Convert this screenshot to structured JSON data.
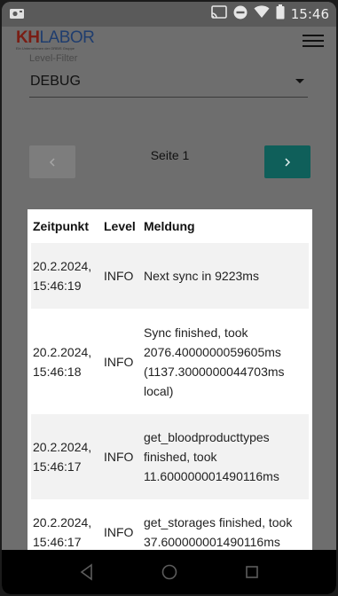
{
  "status_bar": {
    "time": "15:46",
    "icons": [
      "camera-notification-icon",
      "cast-icon",
      "do-not-disturb-icon",
      "wifi-icon",
      "battery-icon"
    ]
  },
  "header": {
    "logo_kh": "KH",
    "logo_labor": "LABOR",
    "logo_tagline": "Ein Unternehmen der ORBIS Gruppe",
    "menu_icon": "hamburger-menu-icon"
  },
  "filter": {
    "label": "Level-Filter",
    "value": "DEBUG"
  },
  "pager": {
    "page_label": "Seite 1",
    "prev_icon": "chevron-left-icon",
    "next_icon": "chevron-right-icon"
  },
  "log_table": {
    "columns": [
      "Zeitpunkt",
      "Level",
      "Meldung"
    ],
    "rows": [
      {
        "date": "20.2.2024,",
        "time": "15:46:19",
        "level": "INFO",
        "message": "Next sync in 9223ms"
      },
      {
        "date": "20.2.2024,",
        "time": "15:46:18",
        "level": "INFO",
        "message": "Sync finished, took 2076.4000000059605ms (1137.3000000044703ms local)"
      },
      {
        "date": "20.2.2024,",
        "time": "15:46:17",
        "level": "INFO",
        "message": "get_bloodproducttypes finished, took 11.600000001490116ms"
      },
      {
        "date": "20.2.2024,",
        "time": "15:46:17",
        "level": "INFO",
        "message": "get_storages finished, took 37.600000001490116ms"
      }
    ]
  },
  "navigation_bar": {
    "buttons": [
      "back-triangle-icon",
      "home-circle-icon",
      "recents-square-icon"
    ]
  }
}
